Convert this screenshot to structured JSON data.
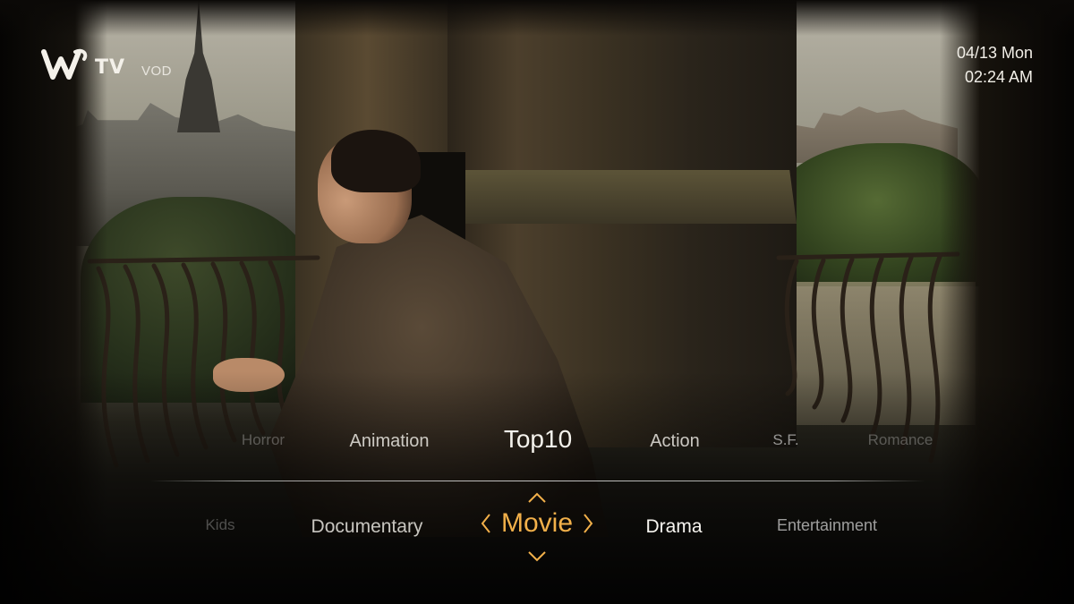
{
  "app": {
    "logo_text": "TV",
    "section": "VOD",
    "accent_color": "#f2b04a"
  },
  "clock": {
    "date": "04/13 Mon",
    "time": "02:24 AM"
  },
  "subcategories": [
    {
      "label": "Horror",
      "state": "faded"
    },
    {
      "label": "Animation",
      "state": "normal"
    },
    {
      "label": "Top10",
      "state": "selected"
    },
    {
      "label": "Action",
      "state": "normal"
    },
    {
      "label": "S.F.",
      "state": "dim"
    },
    {
      "label": "Romance",
      "state": "faded"
    }
  ],
  "categories": {
    "left": [
      {
        "label": "Kids",
        "state": "faded"
      },
      {
        "label": "Documentary",
        "state": "normal"
      }
    ],
    "selected": {
      "label": "Movie"
    },
    "right": [
      {
        "label": "Drama",
        "state": "bright"
      },
      {
        "label": "Entertainment",
        "state": "dim"
      }
    ]
  },
  "icons": {
    "logo": "w-logo-icon",
    "prev": "chevron-left-icon",
    "next": "chevron-right-icon",
    "up": "chevron-up-icon",
    "down": "chevron-down-icon"
  }
}
